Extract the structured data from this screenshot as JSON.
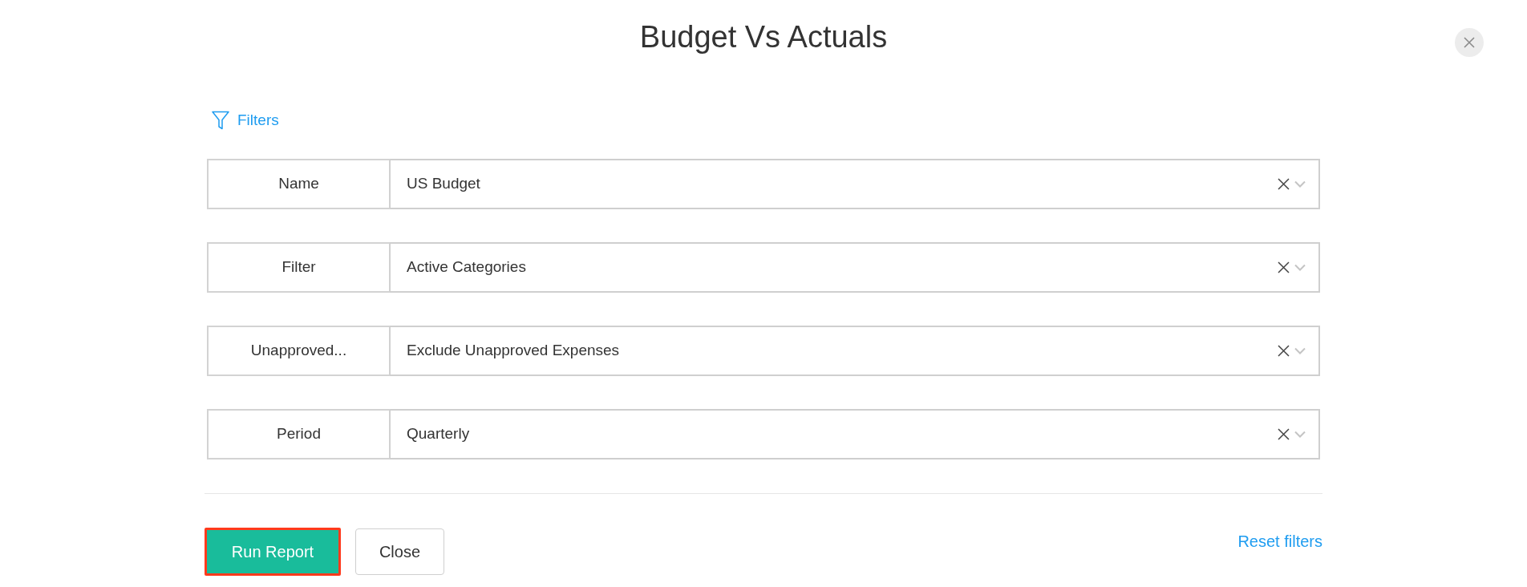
{
  "dialog": {
    "title": "Budget Vs Actuals",
    "filters_link": "Filters",
    "fields": [
      {
        "label": "Name",
        "value": "US Budget"
      },
      {
        "label": "Filter",
        "value": "Active Categories"
      },
      {
        "label": "Unapproved...",
        "value": "Exclude Unapproved Expenses"
      },
      {
        "label": "Period",
        "value": "Quarterly"
      }
    ],
    "buttons": [
      {
        "label": "Run Report",
        "kind": "primary",
        "highlighted": true
      },
      {
        "label": "Close",
        "kind": "secondary",
        "highlighted": false
      }
    ],
    "reset_link": "Reset filters"
  }
}
